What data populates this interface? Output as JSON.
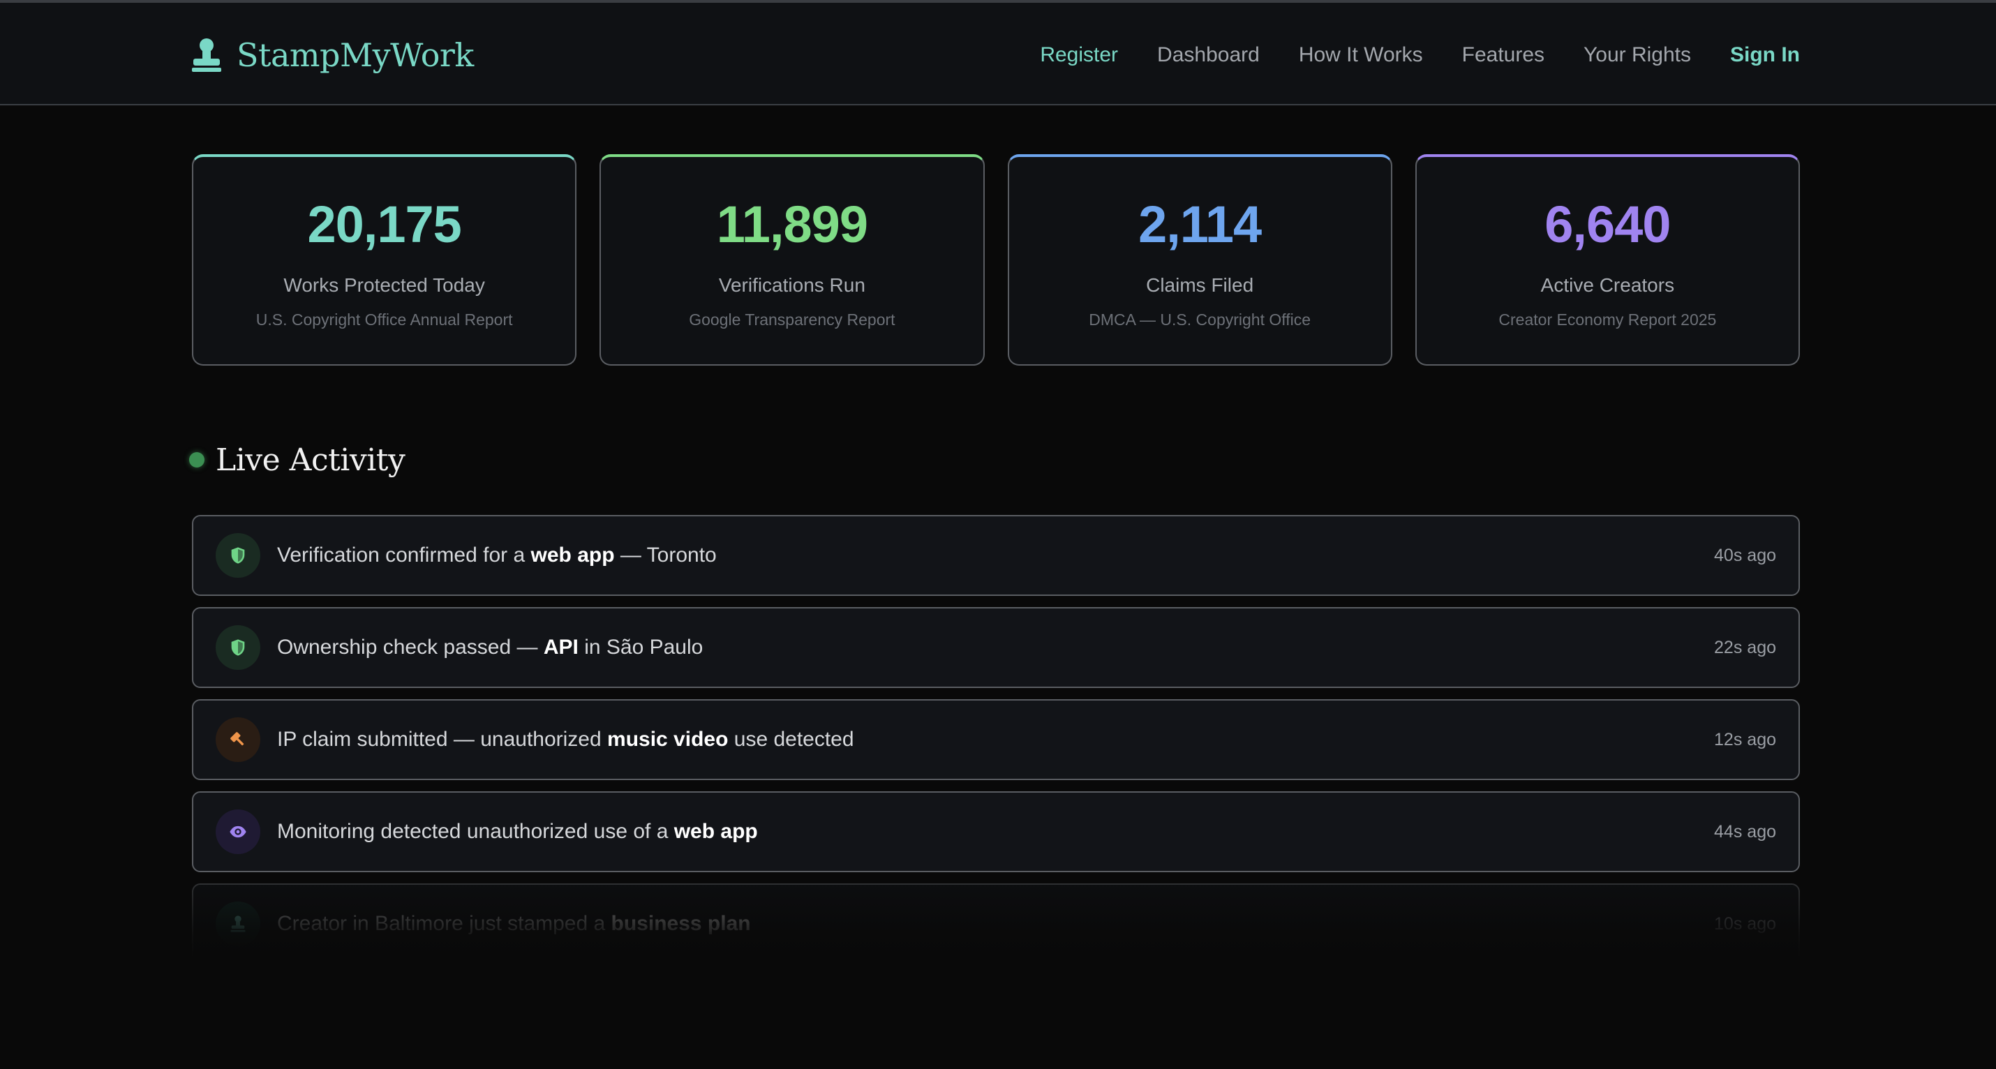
{
  "brand": {
    "name": "StampMyWork",
    "color": "#7ad8c6",
    "icon": "stamp-icon"
  },
  "nav": {
    "register": "Register",
    "dashboard": "Dashboard",
    "how_it_works": "How It Works",
    "features": "Features",
    "your_rights": "Your Rights",
    "sign_in": "Sign In"
  },
  "stats": [
    {
      "value": "20,175",
      "label": "Works Protected Today",
      "source": "U.S. Copyright Office Annual Report",
      "color": "#7ad8c6"
    },
    {
      "value": "11,899",
      "label": "Verifications Run",
      "source": "Google Transparency Report",
      "color": "#7fdc86"
    },
    {
      "value": "2,114",
      "label": "Claims Filed",
      "source": "DMCA — U.S. Copyright Office",
      "color": "#6ea5ee"
    },
    {
      "value": "6,640",
      "label": "Active Creators",
      "source": "Creator Economy Report 2025",
      "color": "#a084f0"
    }
  ],
  "live_activity": {
    "title": "Live Activity",
    "items": [
      {
        "icon": "shield-icon",
        "pre": "Verification confirmed for a ",
        "bold": "web app",
        "post": " — Toronto",
        "time": "40s ago"
      },
      {
        "icon": "shield-icon",
        "pre": "Ownership check passed — ",
        "bold": "API",
        "post": " in São Paulo",
        "time": "22s ago"
      },
      {
        "icon": "gavel-icon",
        "pre": "IP claim submitted — unauthorized ",
        "bold": "music video",
        "post": " use detected",
        "time": "12s ago"
      },
      {
        "icon": "eye-icon",
        "pre": "Monitoring detected unauthorized use of a ",
        "bold": "web app",
        "post": "",
        "time": "44s ago"
      },
      {
        "icon": "stamp-icon",
        "pre": "Creator in Baltimore just stamped a ",
        "bold": "business plan",
        "post": "",
        "time": "10s ago"
      }
    ]
  }
}
